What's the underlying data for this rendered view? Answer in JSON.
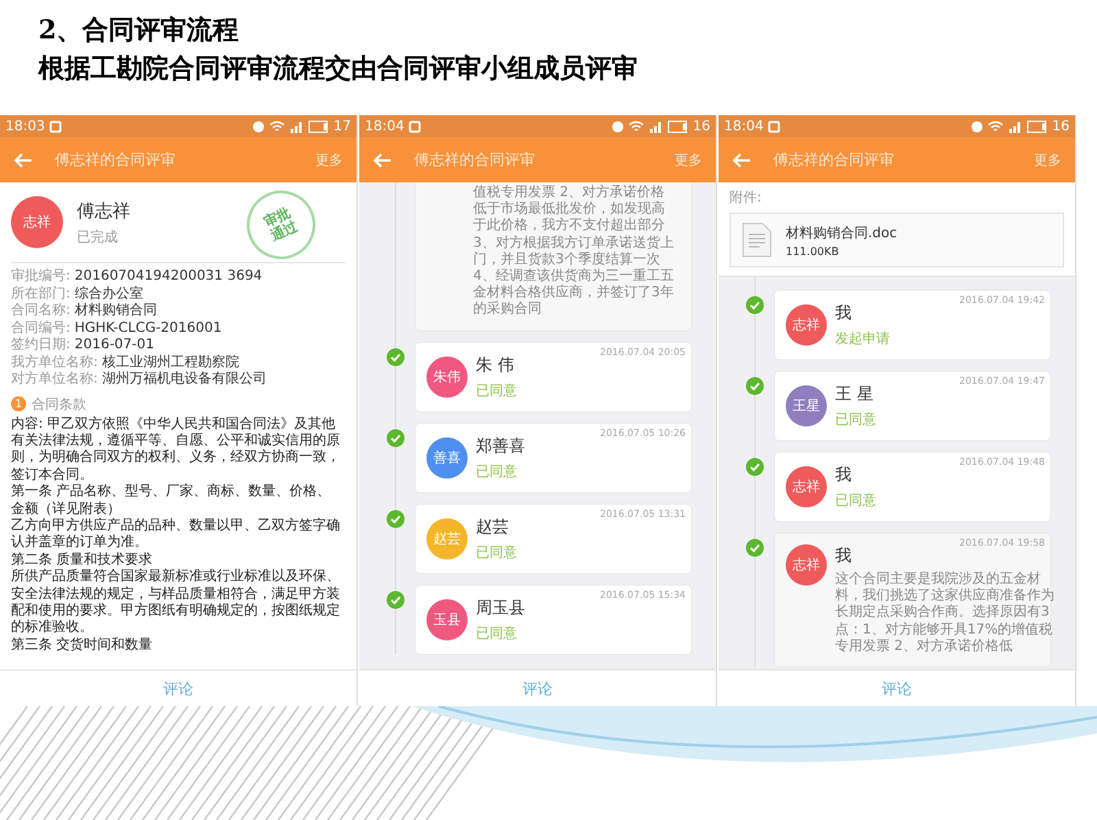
{
  "slide": {
    "title_lines": [
      "2、合同评审流程",
      "根据工勘院合同评审流程交由合同评审小组成员评审"
    ]
  },
  "phones": [
    {
      "kind": "detail",
      "status_bar": {
        "time": "18:03",
        "battery": "17"
      },
      "app_bar": {
        "title": "傅志祥的合同评审",
        "action": "更多"
      },
      "header": {
        "avatar": "志祥",
        "color": "#ef5b5b",
        "name": "傅志祥",
        "status": "已完成",
        "stamp_lines": [
          "审批",
          "通过"
        ]
      },
      "fields": [
        {
          "label": "审批编号:",
          "value": "20160704194200031 3694"
        },
        {
          "label": "所在部门:",
          "value": "综合办公室"
        },
        {
          "label": "合同名称:",
          "value": "材料购销合同"
        },
        {
          "label": "合同编号:",
          "value": "HGHK-CLCG-2016001"
        },
        {
          "label": "签约日期:",
          "value": "2016-07-01"
        },
        {
          "label": "我方单位名称:",
          "value": "核工业湖州工程勘察院"
        },
        {
          "label": "对方单位名称:",
          "value": "湖州万福机电设备有限公司"
        }
      ],
      "section": {
        "number": "1",
        "title": "合同条款"
      },
      "content": [
        "内容: 甲乙双方依照《中华人民共和国合同法》及其他有关法律法规，遵循平等、自愿、公平和诚实信用的原则，为明确合同双方的权利、义务，经双方协商一致，签订本合同。",
        "第一条  产品名称、型号、厂家、商标、数量、价格、金额（详见附表）",
        "乙方向甲方供应产品的品种、数量以甲、乙双方签字确认并盖章的订单为准。",
        "第二条 质量和技术要求",
        "所供产品质量符合国家最新标准或行业标准以及环保、安全法律法规的规定，与样品质量相符合，满足甲方装配和使用的要求。甲方图纸有明确规定的，按图纸规定的标准验收。",
        "第三条 交货时间和数量"
      ],
      "comment_button": "评论"
    },
    {
      "kind": "timeline",
      "status_bar": {
        "time": "18:04",
        "battery": "16"
      },
      "app_bar": {
        "title": "傅志祥的合同评审",
        "action": "更多"
      },
      "continued_comment": "值税专用发票 2、对方承诺价格低于市场最低批发价，如发现高于此价格，我方不支付超出部分 3、对方根据我方订单承诺送货上门，并且货款3个季度结算一次 4、经调查该供货商为三一重工五金材料合格供应商，并签订了3年的采购合同",
      "approvals": [
        {
          "avatar": "朱伟",
          "color": "#f0587f",
          "name": "朱 伟",
          "status": "已同意",
          "time": "2016.07.04 20:05"
        },
        {
          "avatar": "善喜",
          "color": "#4f8ff0",
          "name": "郑善喜",
          "status": "已同意",
          "time": "2016.07.05 10:26"
        },
        {
          "avatar": "赵芸",
          "color": "#f5b52a",
          "name": "赵芸",
          "status": "已同意",
          "time": "2016.07.05 13:31"
        },
        {
          "avatar": "玉县",
          "color": "#f0587f",
          "name": "周玉县",
          "status": "已同意",
          "time": "2016.07.05 15:34"
        }
      ],
      "comment_button": "评论"
    },
    {
      "kind": "timeline",
      "status_bar": {
        "time": "18:04",
        "battery": "16"
      },
      "app_bar": {
        "title": "傅志祥的合同评审",
        "action": "更多"
      },
      "attachment": {
        "label": "附件:",
        "file_name": "材料购销合同.doc",
        "file_size": "111.00KB"
      },
      "approvals": [
        {
          "avatar": "志祥",
          "color": "#ef5b5b",
          "name": "我",
          "status": "发起申请",
          "time": "2016.07.04 19:42"
        },
        {
          "avatar": "王星",
          "color": "#8f7fbf",
          "name": "王 星",
          "status": "已同意",
          "time": "2016.07.04 19:47"
        },
        {
          "avatar": "志祥",
          "color": "#ef5b5b",
          "name": "我",
          "status": "已同意",
          "time": "2016.07.04 19:48"
        },
        {
          "avatar": "志祥",
          "color": "#ef5b5b",
          "name": "我",
          "comment": "这个合同主要是我院涉及的五金材料，我们挑选了这家供应商准备作为长期定点采购合作商。选择原因有3点：1、对方能够开具17%的增值税专用发票 2、对方承诺价格低",
          "time": "2016.07.04 19:58"
        }
      ],
      "comment_button": "评论"
    }
  ]
}
